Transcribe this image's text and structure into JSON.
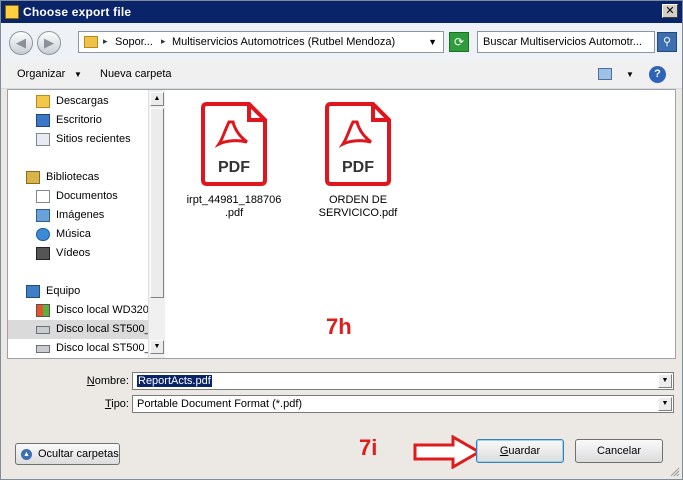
{
  "window": {
    "title": "Choose export file",
    "close_glyph": "✕"
  },
  "address": {
    "segments": [
      "Sopor...",
      "Multiservicios Automotrices (Rutbel Mendoza)"
    ],
    "separator": "▸",
    "icon": "folder-icon"
  },
  "search": {
    "placeholder": "Buscar Multiservicios Automotr..."
  },
  "toolbar": {
    "organize_label": "Organizar",
    "new_folder_label": "Nueva carpeta"
  },
  "sidebar": {
    "items": [
      {
        "label": "Descargas",
        "icon": "downloads-icon",
        "selected": false
      },
      {
        "label": "Escritorio",
        "icon": "desktop-icon",
        "selected": false
      },
      {
        "label": "Sitios recientes",
        "icon": "recent-places-icon",
        "selected": false
      },
      {
        "label": "Bibliotecas",
        "icon": "libraries-icon",
        "selected": false
      },
      {
        "label": "Documentos",
        "icon": "documents-icon",
        "selected": false
      },
      {
        "label": "Imágenes",
        "icon": "pictures-icon",
        "selected": false
      },
      {
        "label": "Música",
        "icon": "music-icon",
        "selected": false
      },
      {
        "label": "Vídeos",
        "icon": "videos-icon",
        "selected": false
      },
      {
        "label": "Equipo",
        "icon": "computer-icon",
        "selected": false
      },
      {
        "label": "Disco local WD320",
        "icon": "windows-drive-icon",
        "selected": false
      },
      {
        "label": "Disco local ST500_",
        "icon": "drive-icon",
        "selected": true
      },
      {
        "label": "Disco local ST500_",
        "icon": "drive-icon",
        "selected": false
      }
    ]
  },
  "files": [
    {
      "name": "irpt_44981_188706\n.pdf",
      "icon": "pdf-file-icon",
      "badge": "PDF"
    },
    {
      "name": "ORDEN DE\nSERVICICO.pdf",
      "icon": "pdf-file-icon",
      "badge": "PDF"
    }
  ],
  "form": {
    "name_label": "Nombre:",
    "name_value": "ReportActs.pdf",
    "type_label": "Tipo:",
    "type_value": "Portable Document Format (*.pdf)"
  },
  "buttons": {
    "hide_folders": "Ocultar carpetas",
    "save": "Guardar",
    "cancel": "Cancelar"
  },
  "annotations": {
    "step_h": "7h",
    "step_i": "7i"
  },
  "colors": {
    "annotation_red": "#e01b1b",
    "pdf_red": "#e0161e",
    "title_bar": "#0a246a"
  }
}
